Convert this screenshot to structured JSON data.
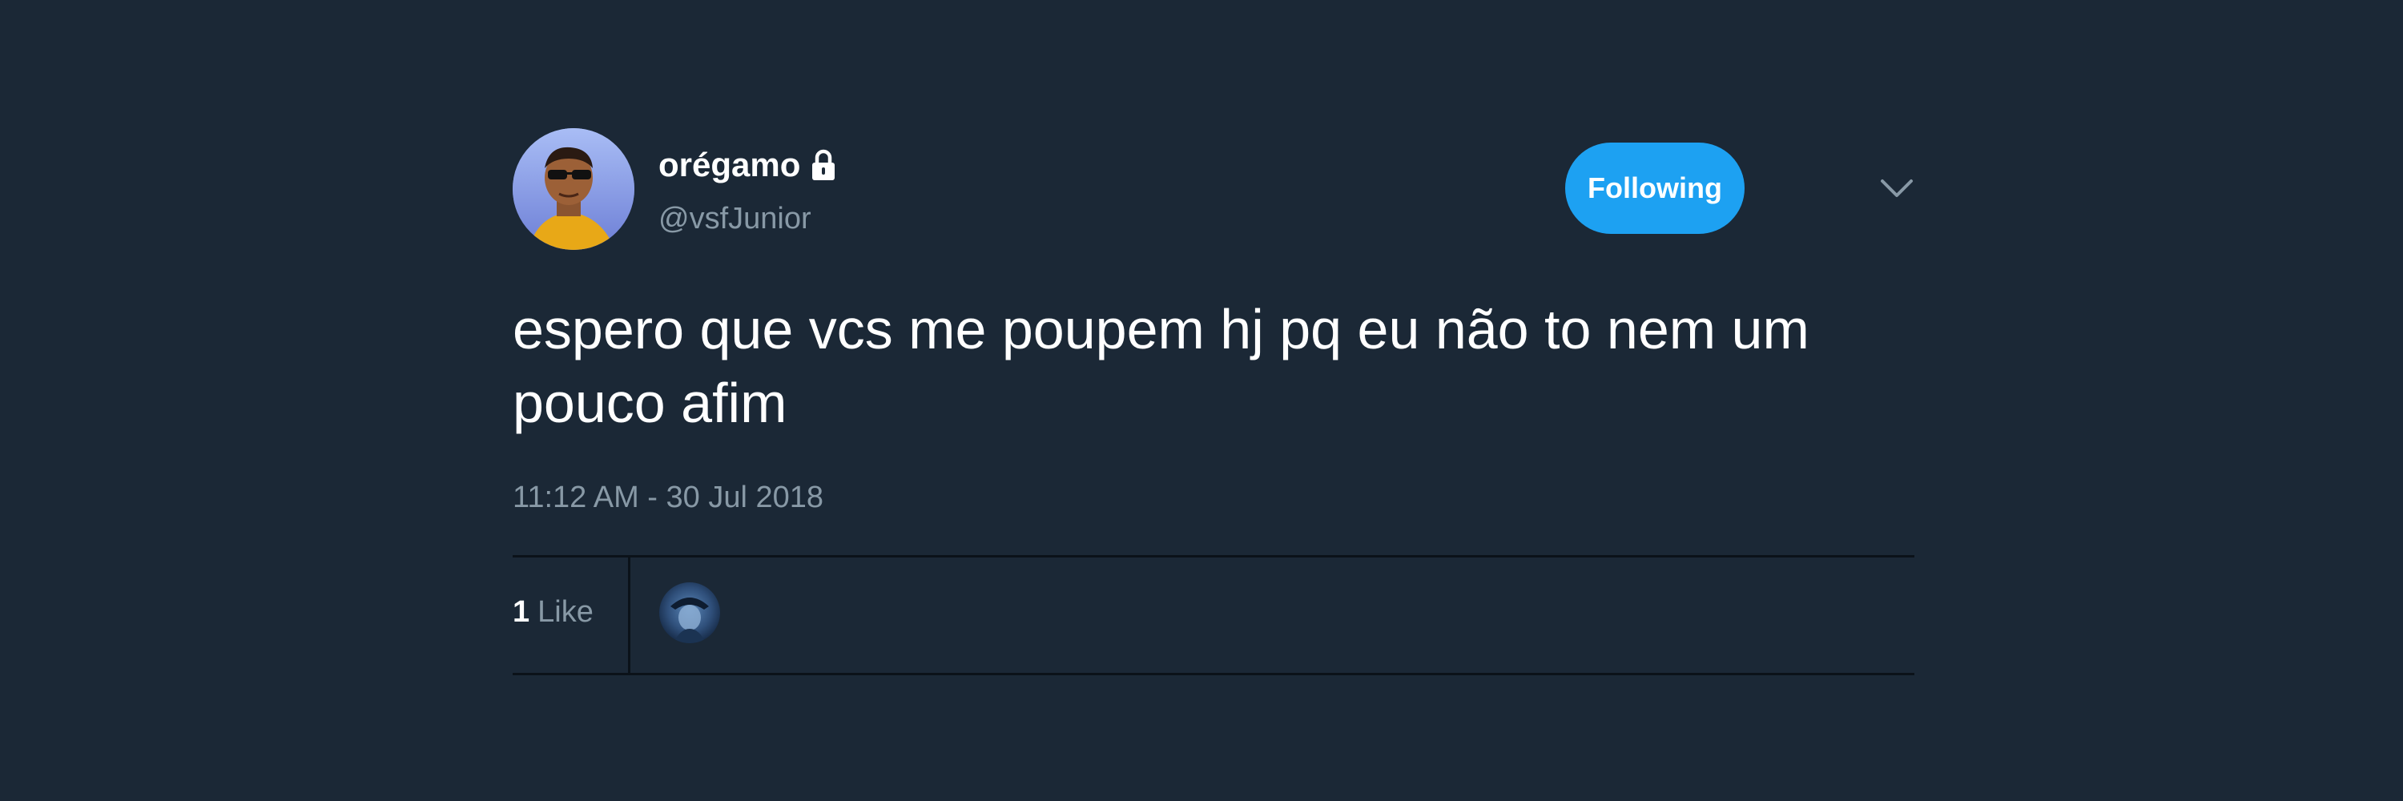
{
  "tweet": {
    "author": {
      "display_name": "orégamo",
      "handle": "@vsfJunior",
      "protected_icon": "lock-icon",
      "avatar": "profile-photo"
    },
    "follow_button_label": "Following",
    "menu_icon": "chevron-down-icon",
    "text": "espero que vcs me poupem hj pq eu não to nem um pouco afim",
    "timestamp": "11:12 AM - 30 Jul 2018",
    "likes": {
      "count": "1",
      "label": "Like"
    },
    "liker_avatar": "liker-profile-photo"
  },
  "colors": {
    "background": "#1b2836",
    "accent": "#1da1f2",
    "secondary_text": "#8899a6",
    "divider": "#0b1219"
  }
}
